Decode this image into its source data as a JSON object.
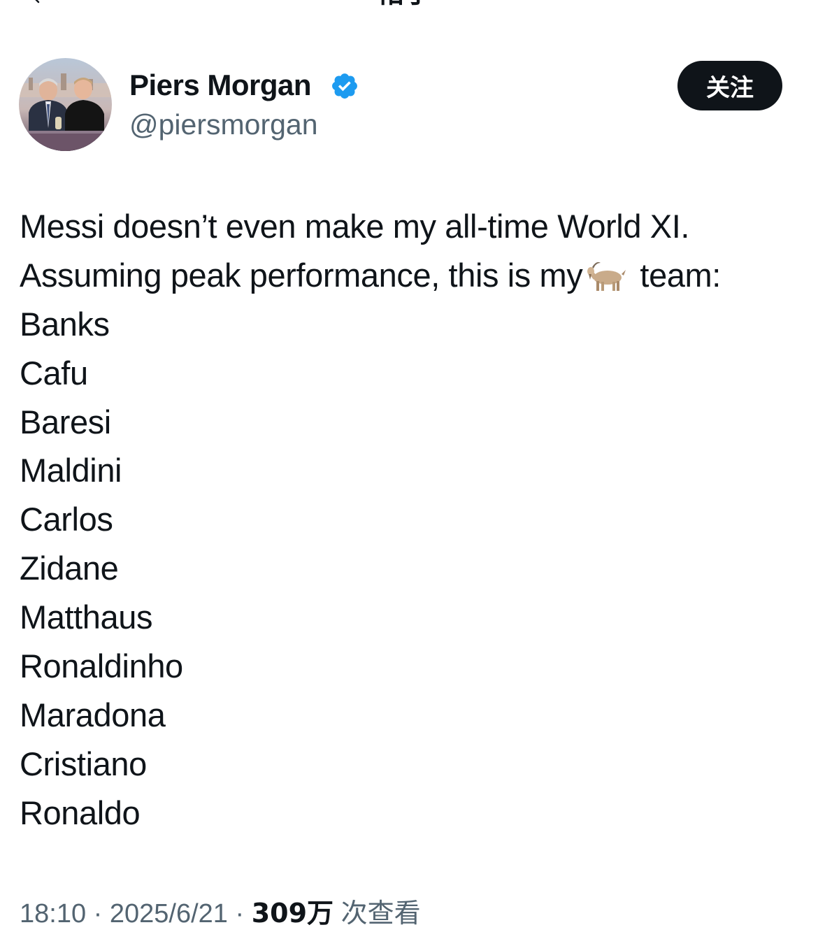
{
  "top_bar": {
    "title": "帖子",
    "back_icon": "back-arrow-icon"
  },
  "author": {
    "name": "Piers Morgan",
    "handle": "@piersmorgan",
    "verified_icon": "verified-badge-icon",
    "verified_color": "#1d9bf0",
    "avatar": "author-avatar"
  },
  "follow_button": {
    "label": "关注",
    "background": "#0f1419",
    "text_color": "#ffffff"
  },
  "tweet": {
    "lines": [
      {
        "text": "Messi doesn’t even make my all-time World XI."
      },
      {
        "before_emoji": "Assuming peak performance, this is my",
        "emoji": "goat-emoji",
        "after_emoji": "team:"
      },
      {
        "text": "Banks"
      },
      {
        "text": "Cafu"
      },
      {
        "text": "Baresi"
      },
      {
        "text": "Maldini"
      },
      {
        "text": "Carlos"
      },
      {
        "text": "Zidane"
      },
      {
        "text": "Matthaus"
      },
      {
        "text": "Ronaldinho"
      },
      {
        "text": "Maradona"
      },
      {
        "text": "Cristiano"
      },
      {
        "text": "Ronaldo"
      }
    ]
  },
  "meta": {
    "time": "18:10",
    "separator": "·",
    "date": "2025/6/21",
    "views_count": "309万",
    "views_label": "次查看"
  },
  "colors": {
    "text_primary": "#0f1419",
    "text_secondary": "#536471",
    "background": "#ffffff"
  }
}
